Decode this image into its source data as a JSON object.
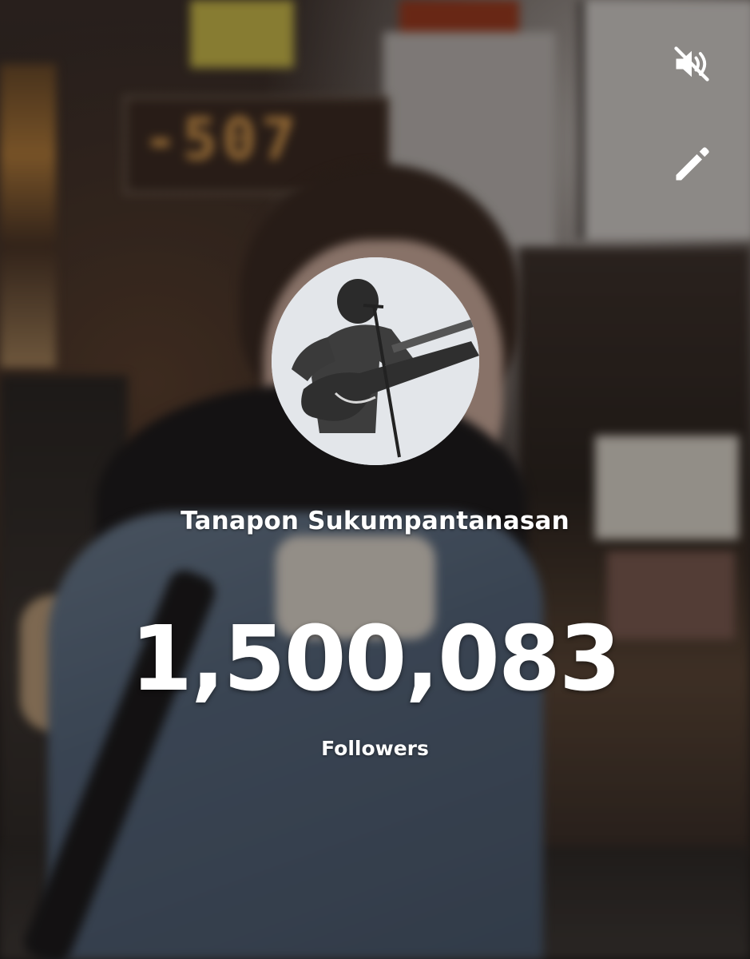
{
  "controls": {
    "mute_icon": "volume-muted-icon",
    "edit_icon": "pencil-icon"
  },
  "background": {
    "sign_text": "-507"
  },
  "profile": {
    "avatar_icon": "guitarist-avatar",
    "name": "Tanapon Sukumpantanasan",
    "follower_count": "1,500,083",
    "follower_label": "Followers"
  },
  "colors": {
    "text": "#ffffff",
    "avatar_bg": "#e3e6ea"
  }
}
